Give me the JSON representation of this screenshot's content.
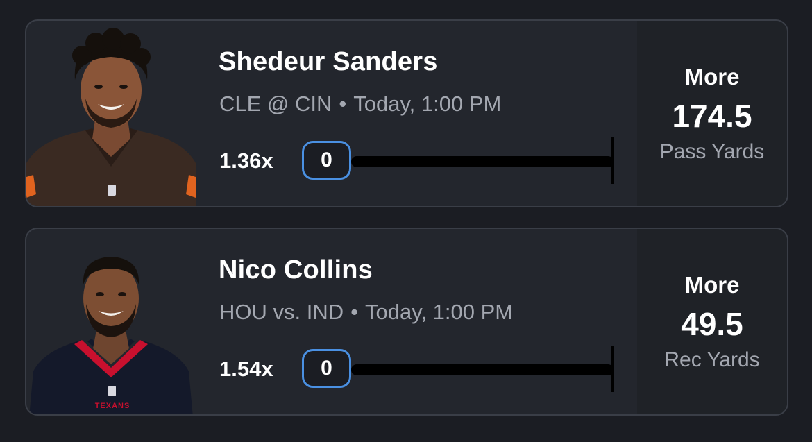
{
  "colors": {
    "background": "#1b1d23",
    "card_background": "#23262d",
    "card_border": "#3a3e47",
    "accent_blue": "#4a90e2",
    "text_primary": "#ffffff",
    "text_secondary": "#a3a7b0"
  },
  "picks": [
    {
      "player_name": "Shedeur Sanders",
      "team": "CLE",
      "opponent_text": "CLE @ CIN",
      "separator": "•",
      "game_time": "Today, 1:00 PM",
      "multiplier": "1.36x",
      "progress_value": "0",
      "direction": "More",
      "line_value": "174.5",
      "stat_type": "Pass Yards",
      "avatar_icon": "player-headshot-cleveland"
    },
    {
      "player_name": "Nico Collins",
      "team": "HOU",
      "opponent_text": "HOU vs. IND",
      "separator": "•",
      "game_time": "Today, 1:00 PM",
      "multiplier": "1.54x",
      "progress_value": "0",
      "direction": "More",
      "line_value": "49.5",
      "stat_type": "Rec Yards",
      "avatar_icon": "player-headshot-texans",
      "jersey_wordmark": "TEXANS"
    }
  ]
}
